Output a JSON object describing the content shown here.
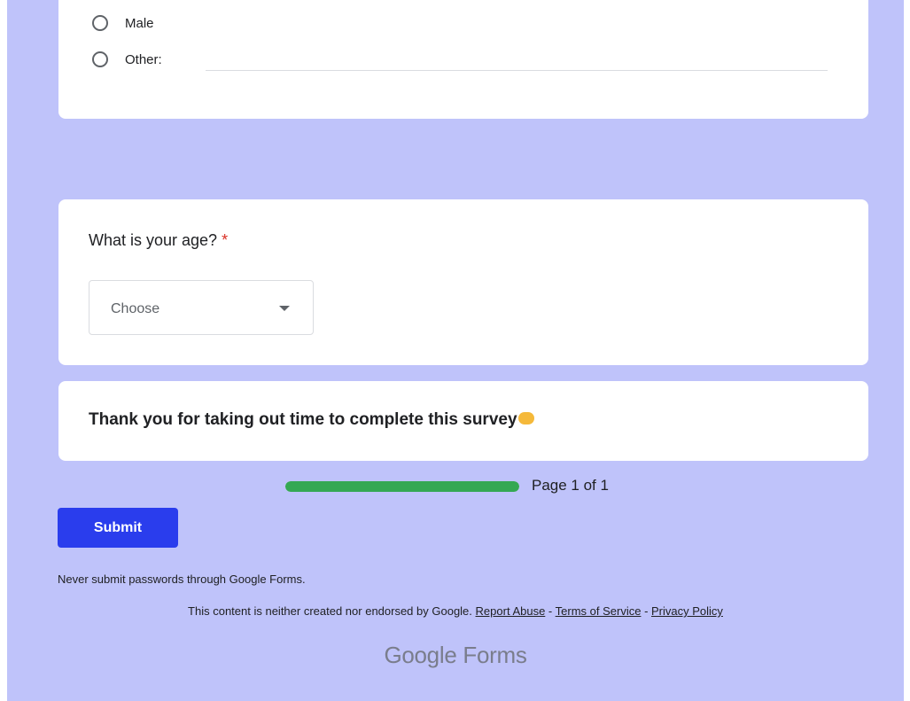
{
  "gender_options": [
    "Male",
    "Other:"
  ],
  "age_question": {
    "title": "What is your age?",
    "required_mark": "*",
    "select_value": "Choose"
  },
  "thanks": {
    "text": "Thank you for taking out time to complete this survey"
  },
  "progress": {
    "label": "Page 1 of 1",
    "fraction": 1.0,
    "color": "#34a853"
  },
  "submit_label": "Submit",
  "footer": {
    "password_warning": "Never submit passwords through Google Forms.",
    "disclaimer": "This content is neither created nor endorsed by Google.",
    "links": [
      "Report Abuse",
      "Terms of Service",
      "Privacy Policy"
    ],
    "separator": " - ",
    "brand": "Google Forms"
  },
  "colors": {
    "background": "#bfc3fa",
    "submit": "#2a3ded",
    "required": "#d93025"
  }
}
